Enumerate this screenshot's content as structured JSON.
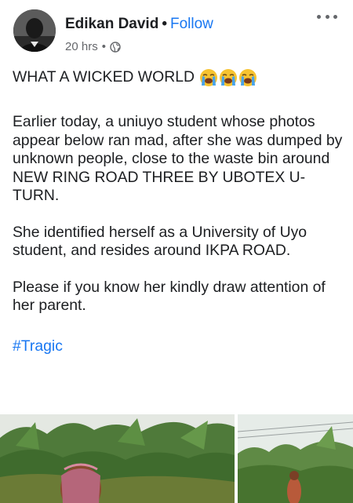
{
  "author": {
    "name": "Edikan David",
    "separator": "•",
    "follow_label": "Follow"
  },
  "meta": {
    "time": "20 hrs",
    "separator": "•",
    "audience_icon": "globe-icon"
  },
  "more_icon": "more-horizontal-icon",
  "post": {
    "headline": "WHAT A WICKED WORLD",
    "headline_emoji": [
      "loudly-crying-face",
      "loudly-crying-face",
      "loudly-crying-face"
    ],
    "paragraphs": [
      "Earlier today, a uniuyo student whose photos appear below ran mad, after she was dumped by unknown people, close to the waste bin around NEW RING ROAD THREE BY UBOTEX U-TURN.",
      "She identified herself as a University of Uyo student, and resides around IKPA ROAD.",
      "Please if you know her kindly draw attention of her parent."
    ],
    "hashtag": "#Tragic"
  },
  "colors": {
    "link": "#1877f2",
    "text": "#1c1e21",
    "meta": "#65676b"
  }
}
